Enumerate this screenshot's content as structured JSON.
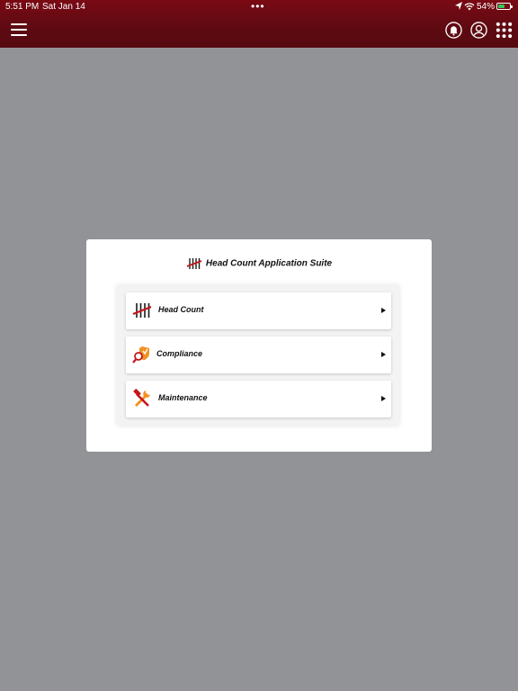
{
  "status_bar": {
    "time": "5:51 PM",
    "date": "Sat Jan 14",
    "battery": "54%",
    "battery_level": 0.54,
    "icons": [
      "location-icon",
      "wifi-icon",
      "battery-icon"
    ]
  },
  "header": {
    "menu_icon": "hamburger-menu-icon",
    "right_icons": [
      "notifications-bell-icon",
      "user-profile-icon",
      "apps-grid-icon"
    ],
    "background": "#5e0a12"
  },
  "card": {
    "title": "Head Count Application Suite",
    "title_icon": "tally-marks-icon",
    "items": [
      {
        "label": "Head Count",
        "icon": "tally-marks-icon"
      },
      {
        "label": "Compliance",
        "icon": "magnifier-shield-icon"
      },
      {
        "label": "Maintenance",
        "icon": "hammer-wrench-icon"
      }
    ]
  },
  "colors": {
    "brand": "#5e0a12",
    "overlay": "#929396",
    "accent_red": "#c4161c",
    "accent_orange": "#f29222"
  }
}
